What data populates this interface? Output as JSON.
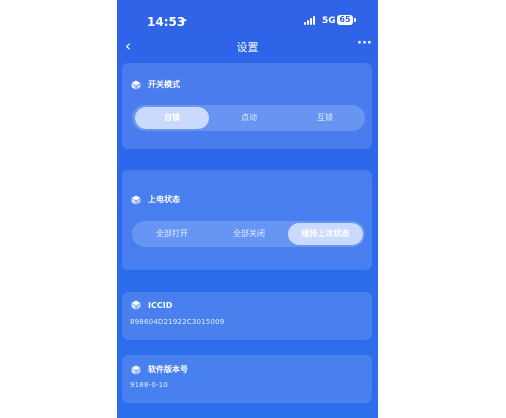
{
  "status_bar": {
    "time": "14:53",
    "network": "5G",
    "battery": "65"
  },
  "nav": {
    "title": "设置",
    "back_icon": "chevron-left-icon",
    "more_icon": "more-icon"
  },
  "switch_mode": {
    "title": "开关模式",
    "options": [
      "自锁",
      "点动",
      "互锁"
    ],
    "selected": "自锁"
  },
  "power_on_state": {
    "title": "上电状态",
    "options": [
      "全部打开",
      "全部关闭",
      "维持上次状态"
    ],
    "selected": "维持上次状态"
  },
  "iccid": {
    "title": "ICCID",
    "value": "898604D21922C3015009"
  },
  "software_version": {
    "title": "软件版本号",
    "value": "9188-0-10"
  },
  "colors": {
    "primary": "#2f63e8",
    "card": "#5f8ff0",
    "text": "#ffffff"
  }
}
